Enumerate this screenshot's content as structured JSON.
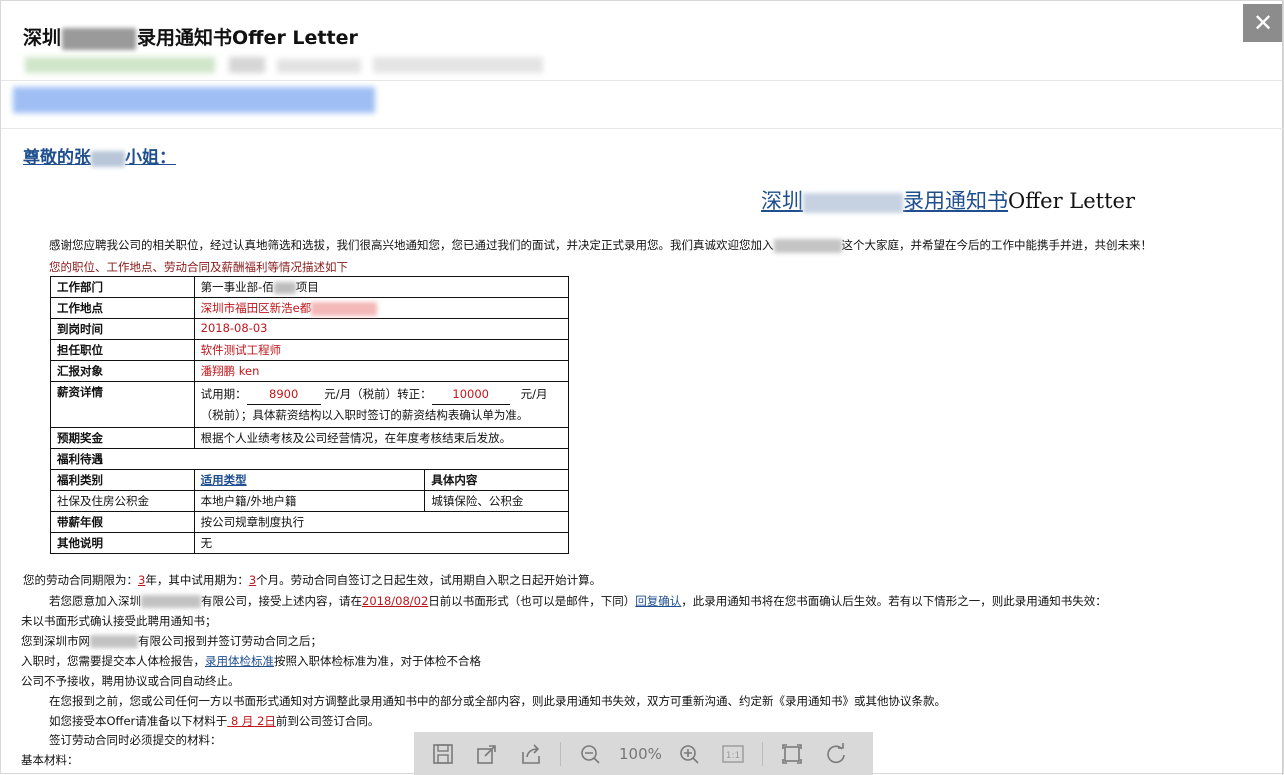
{
  "window": {
    "subject_prefix": "深圳",
    "subject_suffix": "录用通知书Offer Letter",
    "close_glyph": "✕"
  },
  "letter": {
    "greeting_prefix": "尊敬的张",
    "greeting_suffix": "小姐：",
    "title_prefix": "深圳",
    "title_suffix": "录用通知书",
    "title_english": "Offer Letter",
    "intro_a": "感谢您应聘我公司的相关职位，经过认真地筛选和选拔，我们很高兴地通知您，您已通过我们的面试，并决定正式录用您。我们真诚欢迎您加入",
    "intro_b": "这个大家庭，并希望在今后的工作中能携手并进，共创未来！",
    "intro_line2": "您的职位、工作地点、劳动合同及薪酬福利等情况描述如下"
  },
  "table": {
    "department_label": "工作部门",
    "department_value_a": "第一事业部-佰",
    "department_value_b": "项目",
    "location_label": "工作地点",
    "location_value": "深圳市福田区新浩e都",
    "start_label": "到岗时间",
    "start_value": "2018-08-03",
    "position_label": "担任职位",
    "position_value": "软件测试工程师",
    "report_label": "汇报对象",
    "report_value": "潘翔鹏  ken",
    "salary_label": "薪资详情",
    "salary_trial_prefix": "试用期：",
    "salary_trial_amount": "8900",
    "salary_trial_suffix": "元/月（税前）转正：",
    "salary_regular_amount": "10000",
    "salary_regular_suffix": "元/月",
    "salary_note": "（税前）；具体薪资结构以入职时签订的薪资结构表确认单为准。",
    "bonus_label": "预期奖金",
    "bonus_value": "根据个人业绩考核及公司经营情况，在年度考核结束后发放。",
    "welfare_label": "福利待遇",
    "welfare_type_label": "福利类别",
    "welfare_applicable_label": "适用类型",
    "welfare_detail_label": "具体内容",
    "welfare_type_value": "社保及住房公积金",
    "welfare_applicable_value": "本地户籍/外地户籍",
    "welfare_detail_value": "城镇保险、公积金",
    "leave_label": "带薪年假",
    "leave_value": "按公司规章制度执行",
    "other_label": "其他说明",
    "other_value": "无"
  },
  "body": {
    "l1_a": "您的劳动合同期限为：",
    "l1_years": "3",
    "l1_b": "年，其中试用期为：",
    "l1_months": "3",
    "l1_c": "个月。劳动合同自签订之日起生效，试用期自入职之日起开始计算。",
    "l2_a": "若您愿意加入深圳",
    "l2_b": "有限公司，接受上述内容，请在",
    "l2_date": "2018/08/02",
    "l2_c": "日前以书面形式（也可以是邮件，下同）",
    "l2_link": "回复确认",
    "l2_d": "，此录用通知书将在您书面确认后生效。若有以下情形之一，则此录用通知书失效：",
    "l3": "未以书面形式确认接受此聘用通知书；",
    "l4_a": "您到深圳市网",
    "l4_b": "有限公司报到并签订劳动合同之后；",
    "l5_a": "入职时，您需要提交本人体检报告，",
    "l5_link": "录用体检标准",
    "l5_b": "按照入职体检标准为准，对于体检不合格",
    "l6": "公司不予接收，聘用协议或合同自动终止。",
    "l7": "在您报到之前，您或公司任何一方以书面形式通知对方调整此录用通知书中的部分或全部内容，则此录用通知书失效，双方可重新沟通、约定新《录用通知书》或其他协议条款。",
    "l8_a": "如您接受本Offer请准备以下材料于",
    "l8_month": "8",
    "l8_b": "月",
    "l8_day": "2",
    "l8_c": "日",
    "l8_d": "前到公司签订合同。",
    "l9": "签订劳动合同时必须提交的材料：",
    "l10": "基本材料："
  },
  "toolbar": {
    "zoom": "100%",
    "icons": [
      "save-icon",
      "open-external-icon",
      "share-icon",
      "zoom-out-icon",
      "zoom-in-icon",
      "actual-size-icon",
      "fit-screen-icon",
      "rotate-icon"
    ],
    "actual_size_text": "1:1"
  }
}
